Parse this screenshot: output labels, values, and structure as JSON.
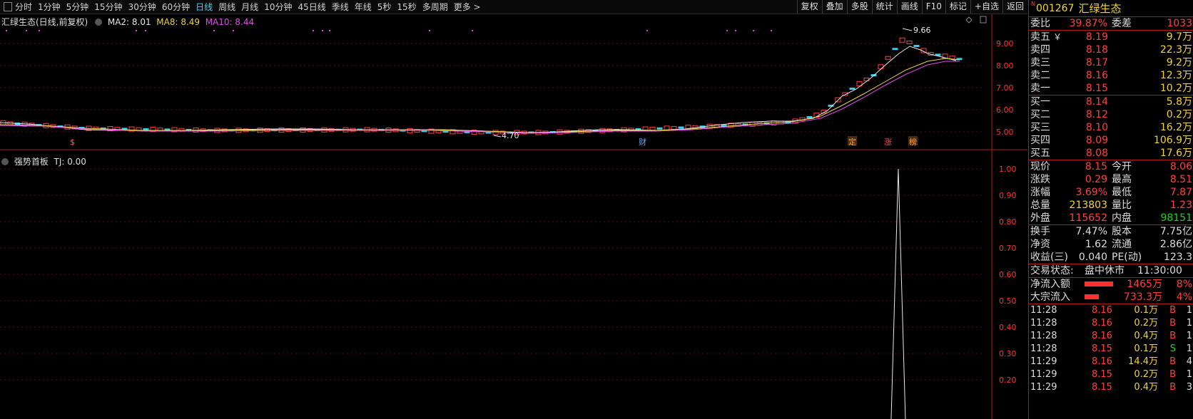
{
  "toolbar": {
    "tabs": [
      "分时",
      "1分钟",
      "5分钟",
      "15分钟",
      "30分钟",
      "60分钟",
      "日线",
      "周线",
      "月线",
      "10分钟",
      "45日线",
      "季线",
      "年线",
      "5秒",
      "15秒",
      "多周期",
      "更多 >"
    ],
    "active_tab": "日线",
    "right_buttons": [
      "复权",
      "叠加",
      "多股",
      "统计",
      "画线",
      "F10",
      "标记",
      "+自选",
      "返回"
    ]
  },
  "main_chart": {
    "title": "汇绿生态(日线,前复权)",
    "ma2": "MA2: 8.01",
    "ma8": "MA8: 8.49",
    "ma10": "MA10: 8.44",
    "high_label": "9.66",
    "low_label": "4.70",
    "event_marks": [
      "$",
      "财",
      "定",
      "涨",
      "榜"
    ],
    "y_ticks": [
      "9.00",
      "8.00",
      "7.00",
      "6.00",
      "5.00"
    ]
  },
  "indicator": {
    "title": "强势首板",
    "tj": "TJ: 0.00",
    "y_ticks": [
      "1.00",
      "0.90",
      "0.80",
      "0.70",
      "0.60",
      "0.50",
      "0.40",
      "0.30",
      "0.20"
    ]
  },
  "chart_data": {
    "type": "line",
    "x": [
      0,
      1,
      2,
      3,
      4,
      5,
      6,
      7,
      8,
      9,
      10,
      11,
      12,
      13,
      14,
      15,
      16,
      17,
      18,
      19,
      20,
      21,
      22,
      23,
      24,
      25,
      26,
      27,
      28,
      29,
      30,
      31,
      32,
      33,
      34,
      35,
      36,
      37,
      38,
      39,
      40,
      41,
      42,
      43,
      44,
      45,
      46,
      47,
      48,
      49,
      50,
      51,
      52,
      53,
      54,
      55,
      56,
      57,
      58,
      59,
      60,
      61,
      62,
      63,
      64,
      65,
      66,
      67,
      68,
      69,
      70,
      71,
      72,
      73,
      74,
      75,
      76,
      77,
      78,
      79,
      80,
      81,
      82,
      83,
      84,
      85,
      86,
      87,
      88,
      89,
      90,
      91,
      92,
      93,
      94,
      95,
      96,
      97,
      98,
      99,
      100,
      101,
      102,
      103,
      104,
      105,
      106,
      107,
      108,
      109,
      110,
      111,
      112,
      113,
      114,
      115,
      116,
      117,
      118,
      119,
      120,
      121,
      122,
      123,
      124,
      125,
      126,
      127,
      128,
      129,
      130,
      131,
      132,
      133,
      134,
      135,
      136,
      137,
      138,
      139,
      140,
      141,
      142,
      143,
      144,
      145,
      146,
      147,
      148,
      149,
      150,
      151,
      152,
      153,
      154,
      155,
      156,
      157,
      158,
      159,
      160,
      161,
      162,
      163,
      164,
      165,
      166,
      167,
      168,
      169,
      170,
      171,
      172,
      173,
      174,
      175,
      176,
      177,
      178,
      179,
      180,
      181,
      182,
      183,
      184,
      185,
      186,
      187,
      188,
      189,
      190,
      191,
      192,
      193,
      194,
      195,
      196,
      197,
      198,
      199,
      200,
      201,
      202,
      203,
      204,
      205,
      206,
      207,
      208,
      209,
      210,
      211,
      212,
      213,
      214,
      215,
      216,
      217,
      218,
      219,
      220,
      221,
      222,
      223,
      224,
      225,
      226,
      227,
      228,
      229,
      230,
      231
    ],
    "series": [
      {
        "name": "TJ",
        "values": [
          0,
          0,
          0,
          0,
          0,
          0,
          0,
          0,
          0,
          0,
          0,
          0,
          0,
          0,
          0,
          0,
          0,
          0,
          0,
          0,
          0,
          0,
          0,
          0,
          0,
          0,
          0,
          0,
          0,
          0,
          0,
          0,
          0,
          0,
          0,
          0,
          0,
          0,
          0,
          0,
          0,
          0,
          0,
          0,
          0,
          0,
          0,
          0,
          0,
          0,
          0,
          0,
          0,
          0,
          0,
          0,
          0,
          0,
          0,
          0,
          0,
          0,
          0,
          0,
          0,
          0,
          0,
          0,
          0,
          0,
          0,
          0,
          0,
          0,
          0,
          0,
          0,
          0,
          0,
          0,
          0,
          0,
          0,
          0,
          0,
          0,
          0,
          0,
          0,
          0,
          0,
          0,
          0,
          0,
          0,
          0,
          0,
          0,
          0,
          0,
          0,
          0,
          0,
          0,
          0,
          0,
          0,
          0,
          0,
          0,
          0,
          0,
          0,
          0,
          0,
          0,
          0,
          0,
          0,
          0,
          0,
          0,
          0,
          0,
          0,
          0,
          0,
          0,
          0,
          0,
          0,
          0,
          0,
          0,
          0,
          0,
          0,
          0,
          0,
          0,
          0,
          0,
          0,
          0,
          0,
          0,
          0,
          0,
          0,
          0,
          0,
          0,
          0,
          0,
          0,
          0,
          0,
          0,
          0,
          0,
          0,
          0,
          0,
          0,
          0,
          0,
          0,
          0,
          0,
          0,
          0,
          0,
          0,
          0,
          0,
          0,
          0,
          0,
          0,
          0,
          0,
          0,
          0,
          0,
          0,
          0,
          0,
          0,
          0,
          0,
          0,
          0,
          0,
          0,
          0,
          0,
          0,
          0,
          0,
          0,
          0,
          0,
          0,
          0,
          0,
          0,
          0,
          0,
          0,
          0,
          0,
          0,
          0,
          0,
          0,
          0,
          0,
          0,
          0,
          0,
          0,
          0,
          1,
          0,
          0,
          0,
          0,
          0,
          0,
          0,
          0,
          0
        ]
      }
    ],
    "ylim": [
      0.2,
      1.0
    ]
  },
  "panel": {
    "code": "001267",
    "name": "汇绿生态",
    "wb": {
      "label": "委比",
      "value": "39.87%",
      "label2": "委差",
      "value2": "1033"
    },
    "asks": [
      {
        "label": "卖五",
        "flag": "￥",
        "price": "8.19",
        "vol": "9.7万"
      },
      {
        "label": "卖四",
        "price": "8.18",
        "vol": "22.3万"
      },
      {
        "label": "卖三",
        "price": "8.17",
        "vol": "9.2万"
      },
      {
        "label": "卖二",
        "price": "8.16",
        "vol": "12.3万"
      },
      {
        "label": "卖一",
        "price": "8.15",
        "vol": "10.2万"
      }
    ],
    "bids": [
      {
        "label": "买一",
        "price": "8.14",
        "vol": "5.8万"
      },
      {
        "label": "买二",
        "price": "8.12",
        "vol": "0.2万"
      },
      {
        "label": "买三",
        "price": "8.10",
        "vol": "16.2万"
      },
      {
        "label": "买四",
        "price": "8.09",
        "vol": "106.9万"
      },
      {
        "label": "买五",
        "price": "8.08",
        "vol": "17.6万"
      }
    ],
    "stats1": [
      {
        "l": "现价",
        "v": "8.15",
        "l2": "今开",
        "v2": "8.06"
      },
      {
        "l": "涨跌",
        "v": "0.29",
        "l2": "最高",
        "v2": "8.51"
      },
      {
        "l": "涨幅",
        "v": "3.69%",
        "l2": "最低",
        "v2": "7.87"
      },
      {
        "l": "总量",
        "v": "213803",
        "l2": "量比",
        "v2": "1.23"
      },
      {
        "l": "外盘",
        "v": "115652",
        "l2": "内盘",
        "v2": "98151"
      }
    ],
    "stats2": [
      {
        "l": "换手",
        "v": "7.47%",
        "l2": "股本",
        "v2": "7.75亿"
      },
      {
        "l": "净资",
        "v": "1.62",
        "l2": "流通",
        "v2": "2.86亿"
      },
      {
        "l": "收益(三)",
        "v": "0.040",
        "l2": "PE(动)",
        "v2": "123.3"
      }
    ],
    "status": {
      "label": "交易状态:",
      "value": "盘中休市",
      "time": "11:30:00"
    },
    "flows": [
      {
        "label": "净流入额",
        "value": "1465万",
        "pct": "8%",
        "level": 0.08
      },
      {
        "label": "大宗流入",
        "value": "733.3万",
        "pct": "4%",
        "level": 0.04
      }
    ],
    "trades": [
      {
        "t": "11:28",
        "p": "8.16",
        "v": "0.1万",
        "s": "B",
        "n": "1"
      },
      {
        "t": "11:28",
        "p": "8.16",
        "v": "0.2万",
        "s": "B",
        "n": "1"
      },
      {
        "t": "11:28",
        "p": "8.16",
        "v": "0.4万",
        "s": "B",
        "n": "1"
      },
      {
        "t": "11:28",
        "p": "8.15",
        "v": "0.1万",
        "s": "S",
        "n": "1"
      },
      {
        "t": "11:29",
        "p": "8.16",
        "v": "14.4万",
        "s": "B",
        "n": "4"
      },
      {
        "t": "11:29",
        "p": "8.15",
        "v": "0.2万",
        "s": "B",
        "n": "1"
      },
      {
        "t": "11:29",
        "p": "8.15",
        "v": "0.4万",
        "s": "B",
        "n": "3"
      }
    ]
  }
}
